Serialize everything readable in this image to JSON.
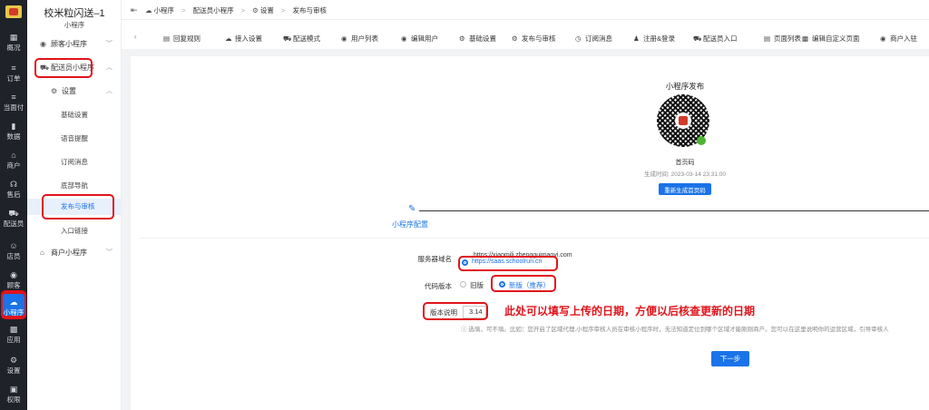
{
  "rail": {
    "items": [
      {
        "label": "概况",
        "icon": "dashboard-icon",
        "glyph": "▦"
      },
      {
        "label": "订单",
        "icon": "order-icon",
        "glyph": "≡"
      },
      {
        "label": "当面付",
        "icon": "pay-icon",
        "glyph": "≡"
      },
      {
        "label": "数据",
        "icon": "chart-icon",
        "glyph": "▮"
      },
      {
        "label": "商户",
        "icon": "store-icon",
        "glyph": "⌂"
      },
      {
        "label": "售后",
        "icon": "headset-icon",
        "glyph": "☊"
      },
      {
        "label": "配送员",
        "icon": "courier-icon",
        "glyph": "⛟"
      },
      {
        "label": "店员",
        "icon": "staff-icon",
        "glyph": "☺"
      },
      {
        "label": "顾客",
        "icon": "customer-icon",
        "glyph": "◉"
      },
      {
        "label": "小程序",
        "icon": "wechat-icon",
        "glyph": "☁"
      },
      {
        "label": "应用",
        "icon": "apps-icon",
        "glyph": "▩"
      },
      {
        "label": "设置",
        "icon": "settings-icon",
        "glyph": "⚙"
      },
      {
        "label": "权限",
        "icon": "lock-icon",
        "glyph": "▣"
      }
    ]
  },
  "subnav": {
    "title": "校米粒闪送–1",
    "subtitle": "小程序",
    "group_customer": "顾客小程序",
    "group_courier": "配送员小程序",
    "group_settings": "设置",
    "items": [
      "基础设置",
      "语音提醒",
      "订阅消息",
      "底部导航",
      "发布与审核",
      "入口链接"
    ],
    "group_merchant": "商户小程序"
  },
  "breadcrumb": [
    "小程序",
    "配送员小程序",
    "设置",
    "发布与审核"
  ],
  "tabs": [
    {
      "label": "回复规则",
      "icon": "reply-icon",
      "glyph": "▤"
    },
    {
      "label": "接入设置",
      "icon": "wechat-icon",
      "glyph": "☁"
    },
    {
      "label": "配送模式",
      "icon": "delivery-icon",
      "glyph": "⛟"
    },
    {
      "label": "用户列表",
      "icon": "user-icon",
      "glyph": "◉"
    },
    {
      "label": "编辑用户",
      "icon": "edit-user-icon",
      "glyph": "◉"
    },
    {
      "label": "基础设置",
      "icon": "gear-icon",
      "glyph": "⚙"
    },
    {
      "label": "发布与审核",
      "icon": "gear-icon",
      "glyph": "⚙"
    },
    {
      "label": "订阅消息",
      "icon": "clock-icon",
      "glyph": "◷"
    },
    {
      "label": "注册&登录",
      "icon": "login-icon",
      "glyph": "♟"
    },
    {
      "label": "配送员入口",
      "icon": "courier-icon",
      "glyph": "⛟"
    },
    {
      "label": "页面列表",
      "icon": "list-icon",
      "glyph": "▤"
    },
    {
      "label": "编辑自定义页面",
      "icon": "grid-icon",
      "glyph": "▩"
    },
    {
      "label": "商户入驻",
      "icon": "user-icon",
      "glyph": "◉"
    }
  ],
  "publish": {
    "title": "小程序发布",
    "qr_label": "首页码",
    "generated": "生成时间: 2023-03-14 23:31:00",
    "regen_button": "重新生成首页码"
  },
  "step": {
    "label": "小程序配置"
  },
  "form": {
    "domain_label": "服务器域名",
    "domain_option_1": "https://xiaomili.zhengguimaoyi.com",
    "domain_option_2": "https://saas.schoolrun.cn",
    "code_label": "代码版本",
    "code_old": "旧版",
    "code_new": "新版（推荐）",
    "version_label": "版本说明",
    "version_value": "3.14",
    "annotation": "此处可以填写上传的日期，方便以后核查更新的日期",
    "hint": "选填，可不填。比如：您开启了区域代理,小程序审核人员在审核小程序时，无法知道定位到哪个区域才能刚刚商户。您可以在这里说明你的运营区域，引导审核人",
    "next_button": "下一步"
  },
  "colors": {
    "accent": "#1a73e8",
    "highlight": "#e1141b",
    "rail": "#1f2229"
  }
}
